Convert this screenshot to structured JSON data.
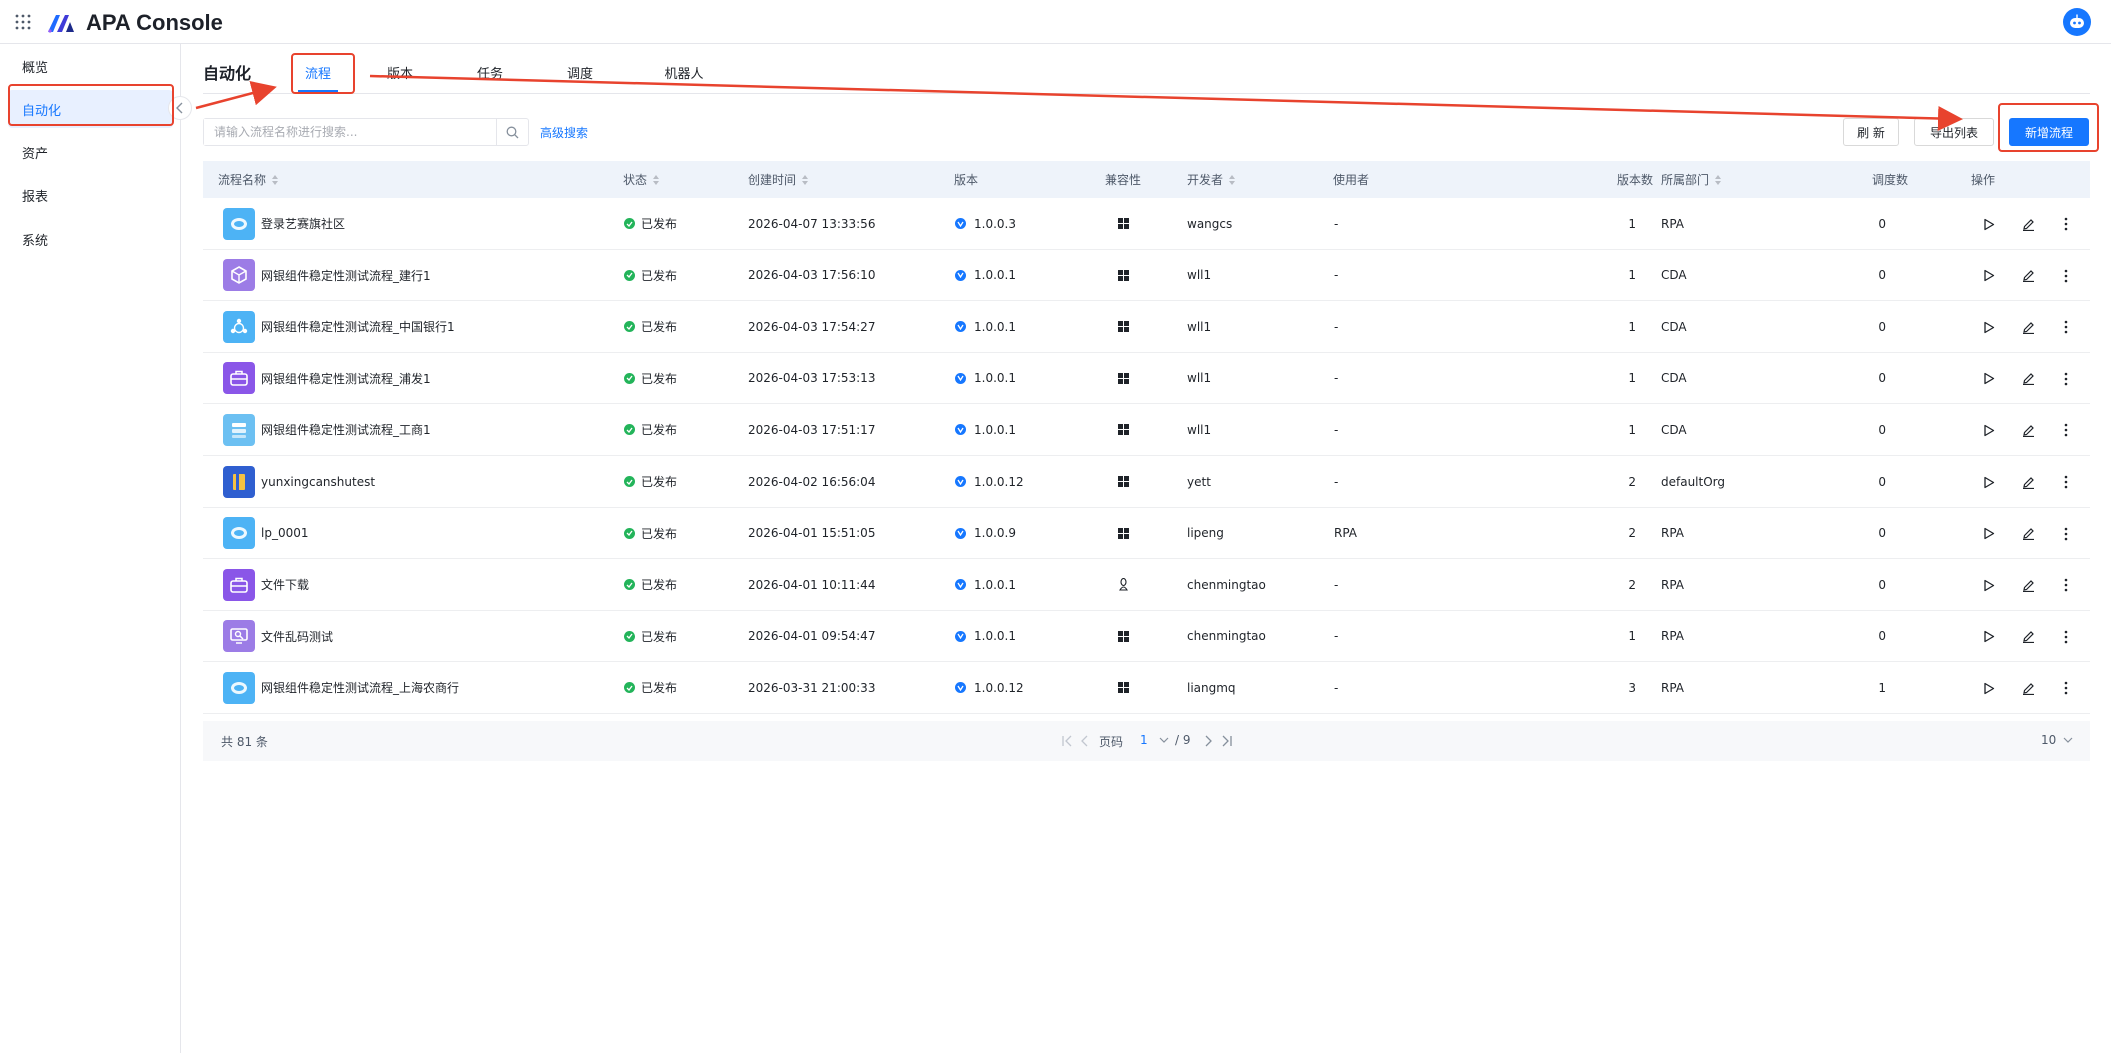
{
  "app": {
    "title": "APA Console"
  },
  "sidebar": {
    "items": [
      {
        "label": "概览"
      },
      {
        "label": "自动化"
      },
      {
        "label": "资产"
      },
      {
        "label": "报表"
      },
      {
        "label": "系统"
      }
    ]
  },
  "header": {
    "title": "自动化",
    "tabs": [
      {
        "label": "流程"
      },
      {
        "label": "版本"
      },
      {
        "label": "任务"
      },
      {
        "label": "调度"
      },
      {
        "label": "机器人"
      }
    ]
  },
  "toolbar": {
    "search_placeholder": "请输入流程名称进行搜索...",
    "advanced_search": "高级搜索",
    "refresh": "刷 新",
    "export": "导出列表",
    "new_process": "新增流程"
  },
  "table": {
    "columns": [
      "流程名称",
      "状态",
      "创建时间",
      "版本",
      "兼容性",
      "开发者",
      "使用者",
      "版本数",
      "所属部门",
      "调度数",
      "操作"
    ],
    "rows": [
      {
        "name": "登录艺赛旗社区",
        "status": "已发布",
        "created": "2026-04-07 13:33:56",
        "version": "1.0.0.3",
        "os": "windows",
        "dev": "wangcs",
        "user": "-",
        "versions": "1",
        "dept": "RPA",
        "schedules": "0",
        "icon": "robot-icon",
        "icon_color": "#4db3f5"
      },
      {
        "name": "网银组件稳定性测试流程_建行1",
        "status": "已发布",
        "created": "2026-04-03 17:56:10",
        "version": "1.0.0.1",
        "os": "windows",
        "dev": "wll1",
        "user": "-",
        "versions": "1",
        "dept": "CDA",
        "schedules": "0",
        "icon": "box-icon",
        "icon_color": "#9c7ce6"
      },
      {
        "name": "网银组件稳定性测试流程_中国银行1",
        "status": "已发布",
        "created": "2026-04-03 17:54:27",
        "version": "1.0.0.1",
        "os": "windows",
        "dev": "wll1",
        "user": "-",
        "versions": "1",
        "dept": "CDA",
        "schedules": "0",
        "icon": "share-icon",
        "icon_color": "#4db3f5"
      },
      {
        "name": "网银组件稳定性测试流程_浦发1",
        "status": "已发布",
        "created": "2026-04-03 17:53:13",
        "version": "1.0.0.1",
        "os": "windows",
        "dev": "wll1",
        "user": "-",
        "versions": "1",
        "dept": "CDA",
        "schedules": "0",
        "icon": "briefcase-icon",
        "icon_color": "#8a56e8"
      },
      {
        "name": "网银组件稳定性测试流程_工商1",
        "status": "已发布",
        "created": "2026-04-03 17:51:17",
        "version": "1.0.0.1",
        "os": "windows",
        "dev": "wll1",
        "user": "-",
        "versions": "1",
        "dept": "CDA",
        "schedules": "0",
        "icon": "list-icon",
        "icon_color": "#6cc0f2"
      },
      {
        "name": "yunxingcanshutest",
        "status": "已发布",
        "created": "2026-04-02 16:56:04",
        "version": "1.0.0.12",
        "os": "windows",
        "dev": "yett",
        "user": "-",
        "versions": "2",
        "dept": "defaultOrg",
        "schedules": "0",
        "icon": "book-icon",
        "icon_color": "#2f5fd0"
      },
      {
        "name": "lp_0001",
        "status": "已发布",
        "created": "2026-04-01 15:51:05",
        "version": "1.0.0.9",
        "os": "windows",
        "dev": "lipeng",
        "user": "RPA",
        "versions": "2",
        "dept": "RPA",
        "schedules": "0",
        "icon": "robot-icon",
        "icon_color": "#4db3f5"
      },
      {
        "name": "文件下载",
        "status": "已发布",
        "created": "2026-04-01 10:11:44",
        "version": "1.0.0.1",
        "os": "linux",
        "dev": "chenmingtao",
        "user": "-",
        "versions": "2",
        "dept": "RPA",
        "schedules": "0",
        "icon": "briefcase-icon",
        "icon_color": "#8a56e8"
      },
      {
        "name": "文件乱码测试",
        "status": "已发布",
        "created": "2026-04-01 09:54:47",
        "version": "1.0.0.1",
        "os": "windows",
        "dev": "chenmingtao",
        "user": "-",
        "versions": "1",
        "dept": "RPA",
        "schedules": "0",
        "icon": "monitor-icon",
        "icon_color": "#9c7ce6"
      },
      {
        "name": "网银组件稳定性测试流程_上海农商行",
        "status": "已发布",
        "created": "2026-03-31 21:00:33",
        "version": "1.0.0.12",
        "os": "windows",
        "dev": "liangmq",
        "user": "-",
        "versions": "3",
        "dept": "RPA",
        "schedules": "1",
        "icon": "robot-icon",
        "icon_color": "#4db3f5"
      }
    ]
  },
  "pagination": {
    "total": "共 81 条",
    "page_label": "页码",
    "current": "1",
    "pages": "/ 9",
    "page_size": "10"
  },
  "colors": {
    "accent": "#1677ff",
    "annotation": "#e8432e",
    "success": "#23b45a"
  }
}
